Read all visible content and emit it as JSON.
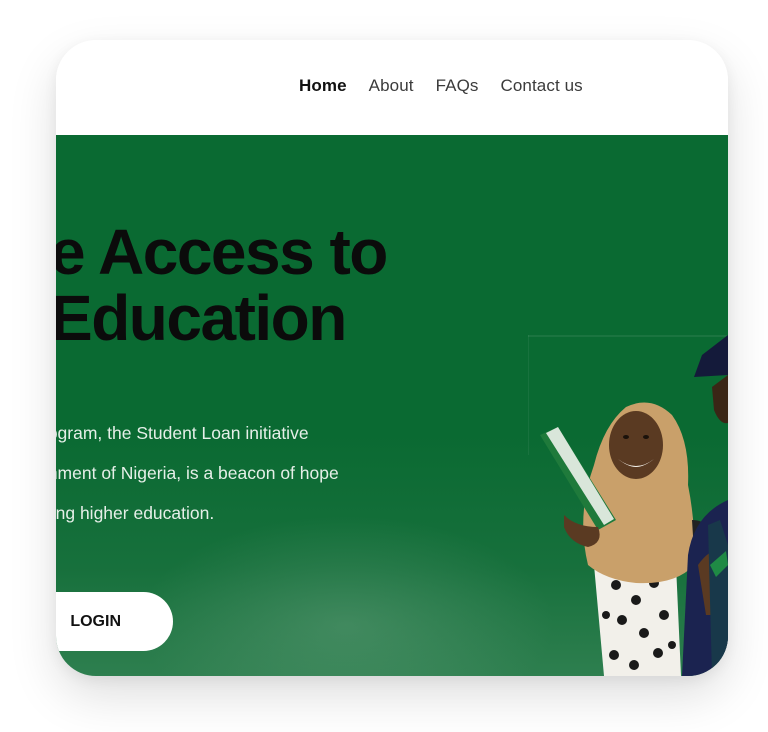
{
  "nav": {
    "links": [
      {
        "label": "Home",
        "active": true
      },
      {
        "label": "About",
        "active": false
      },
      {
        "label": "FAQs",
        "active": false
      },
      {
        "label": "Contact us",
        "active": false
      }
    ]
  },
  "hero": {
    "title_line1": "e Access to",
    "title_line2": "Education",
    "text_line1": "rogram, the Student Loan initiative",
    "text_line2": "rnment of Nigeria, is a beacon of hope",
    "text_line3": "uing higher education.",
    "login_label": "LOGIN",
    "accent_green": "#0a6a32"
  }
}
